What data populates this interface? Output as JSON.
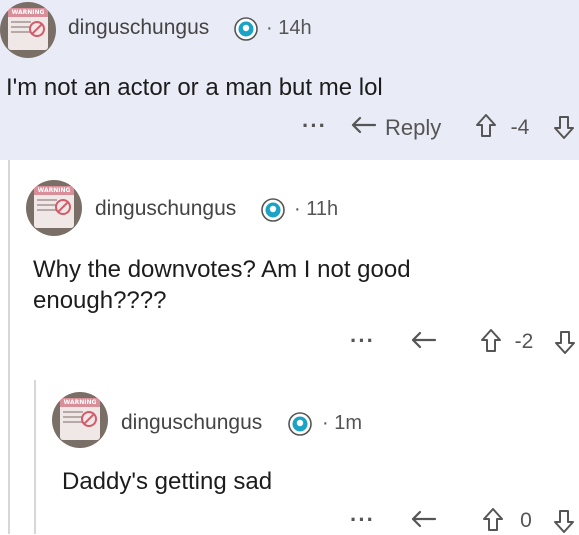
{
  "comments": [
    {
      "username": "dinguschungus",
      "time": "· 14h",
      "body": "I'm not an actor or a man but me lol",
      "more": "···",
      "reply_label": "Reply",
      "score": "-4"
    },
    {
      "username": "dinguschungus",
      "time": "· 11h",
      "body": "Why the downvotes? Am I not good enough????",
      "more": "···",
      "score": "-2"
    },
    {
      "username": "dinguschungus",
      "time": "· 1m",
      "body": "Daddy's getting sad",
      "more": "···",
      "score": "0"
    }
  ],
  "avatar_sign_header": "WARNING",
  "colors": {
    "highlight_bg": "#e9ecf6",
    "thread_line": "#d7d7d7",
    "badge_teal": "#1aa3c6"
  },
  "icons": [
    "avatar",
    "verified-badge-icon",
    "more-options-icon",
    "reply-arrow-icon",
    "upvote-arrow-icon",
    "downvote-arrow-icon"
  ]
}
